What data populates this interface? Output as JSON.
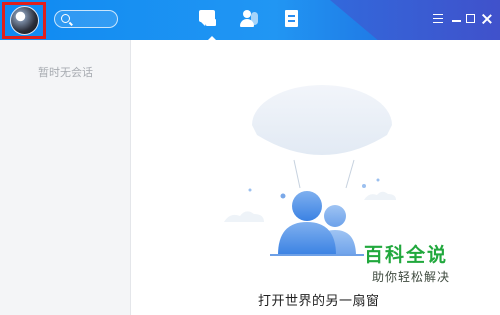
{
  "sidebar": {
    "empty_message": "暂时无会话"
  },
  "header": {
    "tabs": [
      {
        "id": "chat",
        "icon": "chat-bubble-icon",
        "active": true
      },
      {
        "id": "contacts",
        "icon": "contacts-icon"
      },
      {
        "id": "notes",
        "icon": "notes-icon"
      }
    ],
    "window_controls": [
      "menu-icon",
      "minimize-icon",
      "maximize-icon",
      "close-icon"
    ]
  },
  "main": {
    "empty_title": "打开世界的另一扇窗",
    "empty_subtitle": "...."
  },
  "watermark": {
    "title": "百科全说",
    "subtitle": "助你轻松解决"
  },
  "colors": {
    "titlebar": "#1e8ff0",
    "highlight_border": "#e0201b",
    "watermark_green": "#21a83d"
  }
}
